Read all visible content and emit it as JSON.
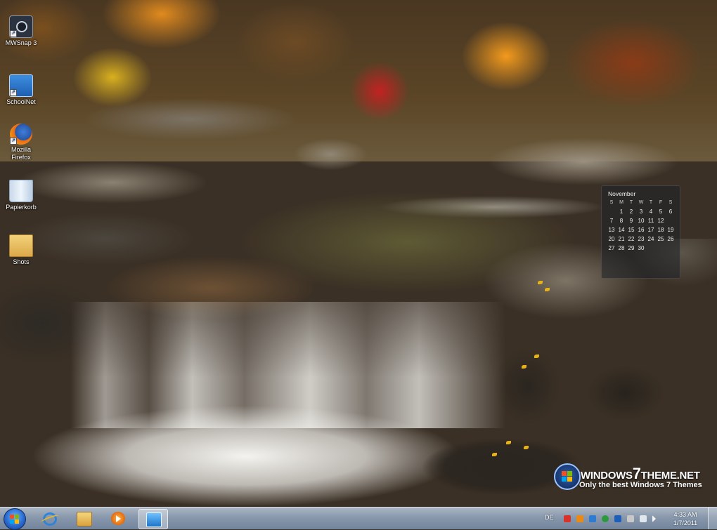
{
  "desktop": {
    "icons": [
      {
        "label": "MWSnap 3",
        "icon": "camera-icon"
      },
      {
        "label": "SchoolNet",
        "icon": "app-icon"
      },
      {
        "label": "Mozilla Firefox",
        "icon": "firefox-icon"
      },
      {
        "label": "Papierkorb",
        "icon": "recycle-bin-icon"
      },
      {
        "label": "Shots",
        "icon": "folder-icon"
      }
    ]
  },
  "calendar": {
    "month": "November",
    "weekdays": [
      "S",
      "M",
      "T",
      "W",
      "T",
      "F",
      "S"
    ],
    "weeks": [
      [
        "",
        "1",
        "2",
        "3",
        "4",
        "5",
        "6"
      ],
      [
        "7",
        "8",
        "9",
        "10",
        "11",
        "12",
        ""
      ],
      [
        "13",
        "14",
        "15",
        "16",
        "17",
        "18",
        "19"
      ],
      [
        "20",
        "21",
        "22",
        "23",
        "24",
        "25",
        "26"
      ],
      [
        "27",
        "28",
        "29",
        "30",
        "",
        "",
        ""
      ]
    ]
  },
  "watermark": {
    "title_prefix": "WINDOWS",
    "title_seven": "7",
    "title_suffix": "THEME.NET",
    "subtitle": "Only the best Windows 7 Themes"
  },
  "taskbar": {
    "pinned": [
      {
        "name": "internet-explorer",
        "icon": "ie-icon"
      },
      {
        "name": "file-explorer",
        "icon": "folder-icon"
      },
      {
        "name": "media-player",
        "icon": "media-player-icon"
      },
      {
        "name": "screen-app",
        "icon": "screen-icon",
        "active": true
      }
    ],
    "tray": {
      "language": "DE",
      "time": "4:33 AM",
      "date": "1/7/2011"
    }
  },
  "colors": {
    "taskbar": "#93aac4",
    "start_orb": "#2a6bd1",
    "calendar_bg": "#1e2228"
  }
}
